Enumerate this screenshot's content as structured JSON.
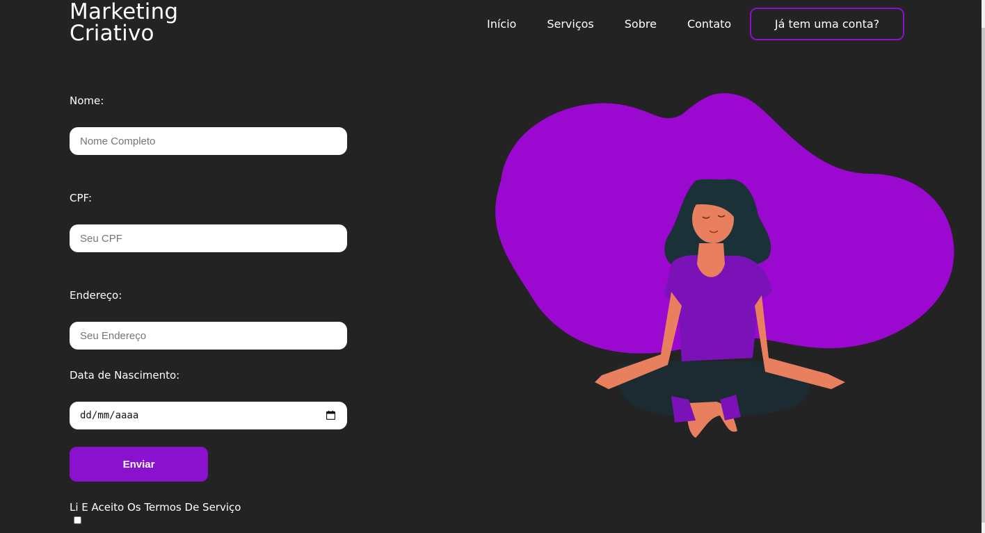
{
  "brand": {
    "line1": "Marketing",
    "line2": "Criativo"
  },
  "nav": {
    "items": [
      {
        "label": "Início"
      },
      {
        "label": "Serviços"
      },
      {
        "label": "Sobre"
      },
      {
        "label": "Contato"
      }
    ],
    "account_button": "Já tem uma conta?"
  },
  "form": {
    "name": {
      "label": "Nome:",
      "placeholder": "Nome Completo",
      "value": ""
    },
    "cpf": {
      "label": "CPF:",
      "placeholder": "Seu CPF",
      "value": ""
    },
    "address": {
      "label": "Endereço:",
      "placeholder": "Seu Endereço",
      "value": ""
    },
    "birthdate": {
      "label": "Data de Nascimento:",
      "value_display": "dd/mm/aaaa"
    },
    "submit_label": "Enviar",
    "terms_label": "Li E Aceito Os Termos De Serviço",
    "terms_checked": false
  },
  "colors": {
    "background": "#232323",
    "accent": "#8a12cf",
    "blob": "#9b08cf",
    "skin": "#e8805f",
    "hair": "#1b3138"
  },
  "icons": {
    "date_picker": "calendar-icon"
  }
}
